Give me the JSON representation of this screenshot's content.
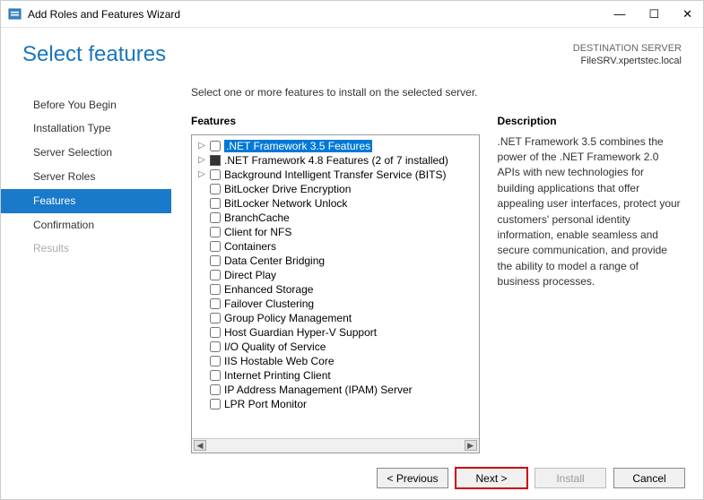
{
  "window": {
    "title": "Add Roles and Features Wizard"
  },
  "header": {
    "heading": "Select features",
    "dest_label": "DESTINATION SERVER",
    "dest_value": "FileSRV.xpertstec.local"
  },
  "nav": {
    "items": [
      {
        "label": "Before You Begin",
        "active": false,
        "disabled": false
      },
      {
        "label": "Installation Type",
        "active": false,
        "disabled": false
      },
      {
        "label": "Server Selection",
        "active": false,
        "disabled": false
      },
      {
        "label": "Server Roles",
        "active": false,
        "disabled": false
      },
      {
        "label": "Features",
        "active": true,
        "disabled": false
      },
      {
        "label": "Confirmation",
        "active": false,
        "disabled": false
      },
      {
        "label": "Results",
        "active": false,
        "disabled": true
      }
    ]
  },
  "main": {
    "instruction": "Select one or more features to install on the selected server.",
    "features_label": "Features",
    "description_label": "Description",
    "description_text": ".NET Framework 3.5 combines the power of the .NET Framework 2.0 APIs with new technologies for building applications that offer appealing user interfaces, protect your customers' personal identity information, enable seamless and secure communication, and provide the ability to model a range of business processes."
  },
  "features": [
    {
      "label": ".NET Framework 3.5 Features",
      "expandable": true,
      "checked": false,
      "selected": true
    },
    {
      "label": ".NET Framework 4.8 Features (2 of 7 installed)",
      "expandable": true,
      "checked": "partial",
      "selected": false
    },
    {
      "label": "Background Intelligent Transfer Service (BITS)",
      "expandable": true,
      "checked": false,
      "selected": false
    },
    {
      "label": "BitLocker Drive Encryption",
      "expandable": false,
      "checked": false,
      "selected": false
    },
    {
      "label": "BitLocker Network Unlock",
      "expandable": false,
      "checked": false,
      "selected": false
    },
    {
      "label": "BranchCache",
      "expandable": false,
      "checked": false,
      "selected": false
    },
    {
      "label": "Client for NFS",
      "expandable": false,
      "checked": false,
      "selected": false
    },
    {
      "label": "Containers",
      "expandable": false,
      "checked": false,
      "selected": false
    },
    {
      "label": "Data Center Bridging",
      "expandable": false,
      "checked": false,
      "selected": false
    },
    {
      "label": "Direct Play",
      "expandable": false,
      "checked": false,
      "selected": false
    },
    {
      "label": "Enhanced Storage",
      "expandable": false,
      "checked": false,
      "selected": false
    },
    {
      "label": "Failover Clustering",
      "expandable": false,
      "checked": false,
      "selected": false
    },
    {
      "label": "Group Policy Management",
      "expandable": false,
      "checked": false,
      "selected": false
    },
    {
      "label": "Host Guardian Hyper-V Support",
      "expandable": false,
      "checked": false,
      "selected": false
    },
    {
      "label": "I/O Quality of Service",
      "expandable": false,
      "checked": false,
      "selected": false
    },
    {
      "label": "IIS Hostable Web Core",
      "expandable": false,
      "checked": false,
      "selected": false
    },
    {
      "label": "Internet Printing Client",
      "expandable": false,
      "checked": false,
      "selected": false
    },
    {
      "label": "IP Address Management (IPAM) Server",
      "expandable": false,
      "checked": false,
      "selected": false
    },
    {
      "label": "LPR Port Monitor",
      "expandable": false,
      "checked": false,
      "selected": false
    }
  ],
  "footer": {
    "previous": "< Previous",
    "next": "Next >",
    "install": "Install",
    "cancel": "Cancel"
  }
}
